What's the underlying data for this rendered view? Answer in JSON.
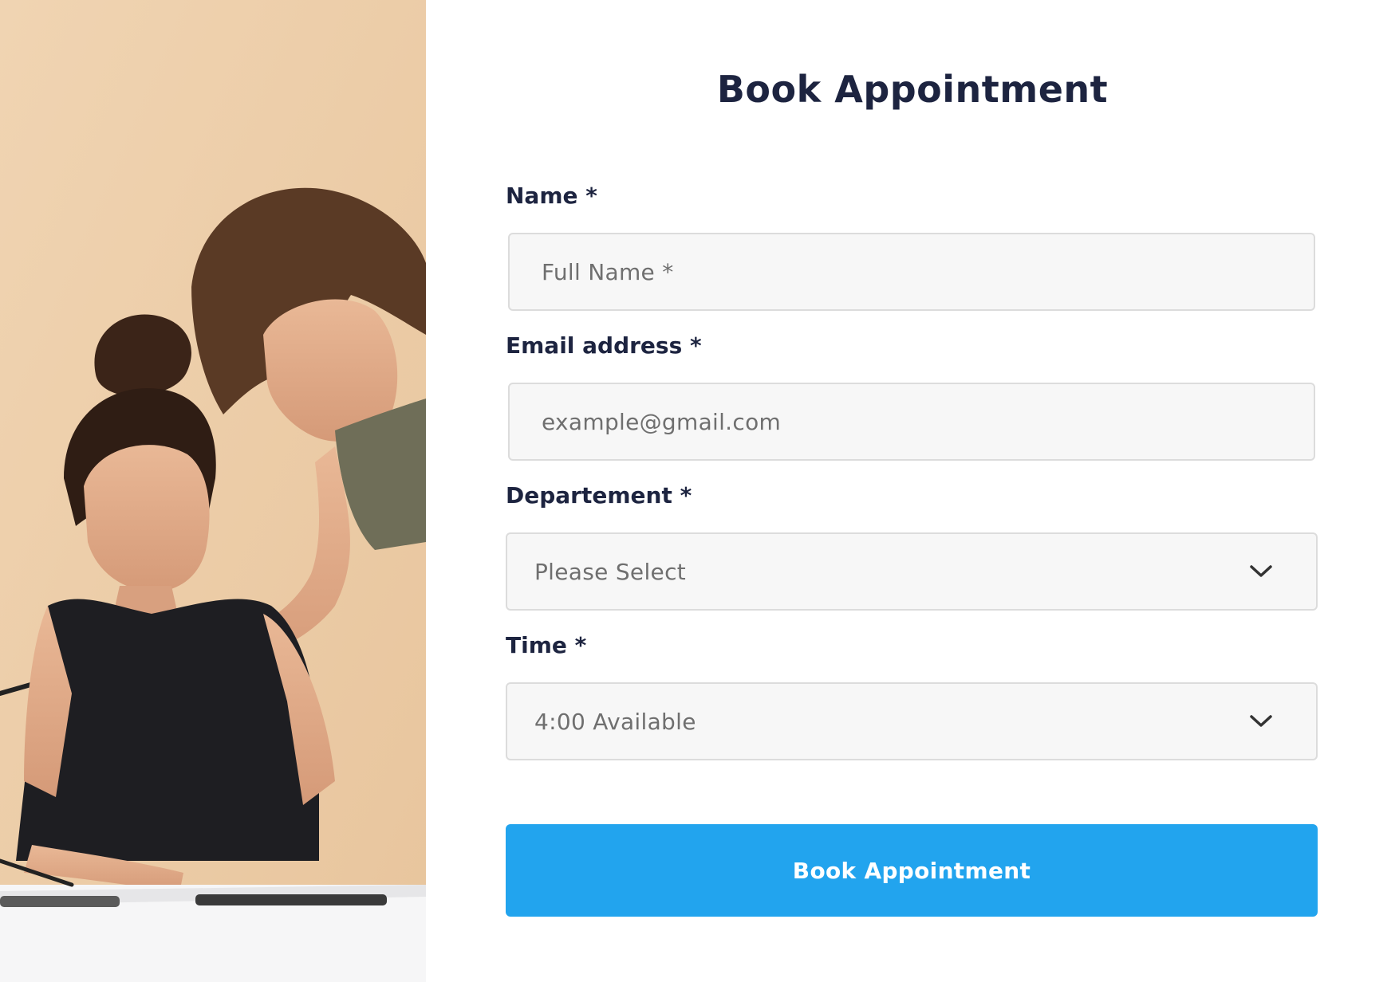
{
  "form": {
    "title": "Book Appointment",
    "fields": [
      {
        "label": "Name *",
        "type": "input",
        "value": "",
        "placeholder": "Full Name *"
      },
      {
        "label": "Email address *",
        "type": "input",
        "value": "",
        "placeholder": "example@gmail.com"
      },
      {
        "label": "Departement *",
        "type": "select",
        "selected": "Please Select"
      },
      {
        "label": "Time *",
        "type": "select",
        "selected": "4:00 Available"
      }
    ],
    "submit_label": "Book Appointment"
  },
  "colors": {
    "accent": "#22a4ee",
    "heading": "#1d2440",
    "field_bg": "#f7f7f7",
    "field_border": "#dcdcdc",
    "photo_bg": "#efd1ad"
  },
  "icons": {
    "select_arrow": "chevron-down-icon"
  }
}
